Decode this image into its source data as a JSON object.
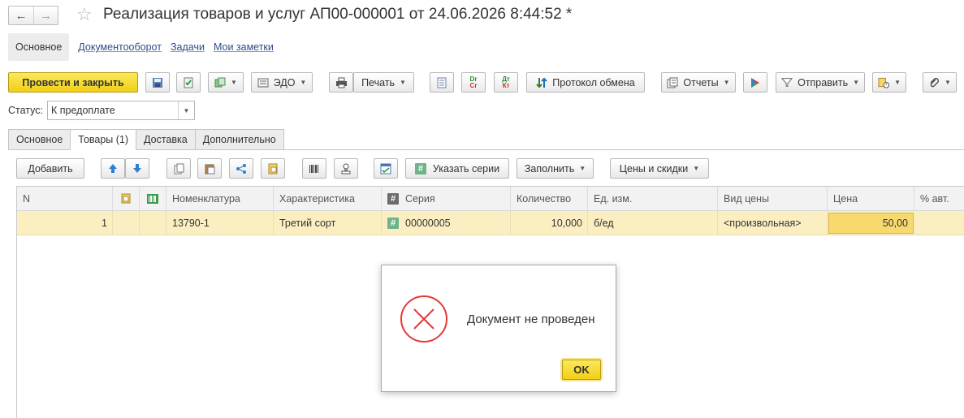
{
  "window": {
    "title": "Реализация товаров и услуг АП00-000001 от 24.06.2026 8:44:52 *"
  },
  "nav_links": {
    "active": "Основное",
    "items": [
      "Документооборот",
      "Задачи",
      "Мои заметки"
    ]
  },
  "toolbar": {
    "post_close": "Провести и закрыть",
    "edo": "ЭДО",
    "print": "Печать",
    "exchange_log": "Протокол обмена",
    "reports": "Отчеты",
    "send": "Отправить",
    "dr_cr_top": "Dr",
    "dr_cr_bottom": "Cr",
    "dt_kt_top": "Дт",
    "dt_kt_bottom": "Кт"
  },
  "status": {
    "label": "Статус:",
    "value": "К предоплате"
  },
  "tabs": [
    "Основное",
    "Товары (1)",
    "Доставка",
    "Дополнительно"
  ],
  "table_toolbar": {
    "add": "Добавить",
    "set_series": "Указать серии",
    "fill": "Заполнить",
    "prices_discounts": "Цены и скидки"
  },
  "table": {
    "columns": [
      "N",
      "Номенклатура",
      "Характеристика",
      "Серия",
      "Количество",
      "Ед. изм.",
      "Вид цены",
      "Цена",
      "% авт."
    ],
    "rows": [
      {
        "n": "1",
        "item": "13790-1",
        "characteristic": "Третий сорт",
        "series": "00000005",
        "quantity": "10,000",
        "unit": "б/ед",
        "price_type": "<произвольная>",
        "price": "50,00"
      }
    ]
  },
  "dialog": {
    "message": "Документ не проведен",
    "ok": "OK"
  },
  "colors": {
    "accent_yellow": "#f2cf17",
    "row_highlight": "#fbefc2",
    "error_red": "#e53935",
    "link": "#2d4d8a"
  }
}
